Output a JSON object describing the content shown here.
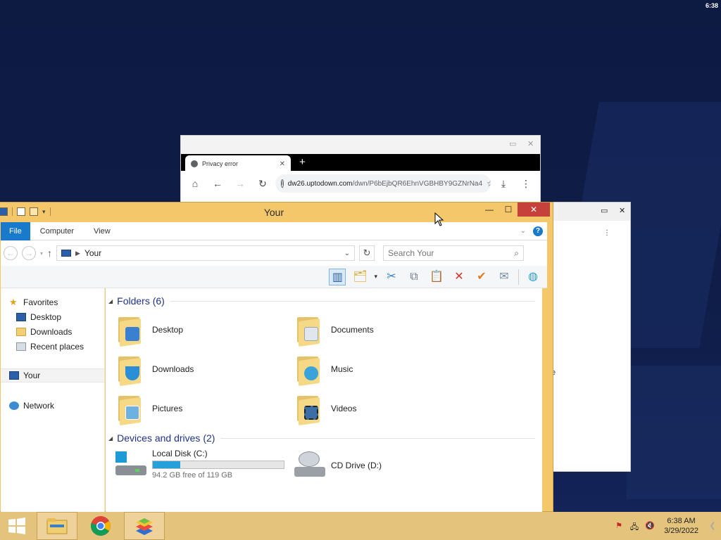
{
  "desktop": {
    "corner_clock": "6:38"
  },
  "chrome": {
    "tab_title": "Privacy error",
    "new_tab": "+",
    "url_host": "dw26.uptodown.com",
    "url_path": "/dwn/P6bEjbQR6EhnVGBHBY9GZNrNa4",
    "minimize": "▭",
    "close": "✕"
  },
  "side_window": {
    "restore": "▭",
    "close": "✕",
    "menu": "⋮",
    "cut_text": "e"
  },
  "explorer": {
    "title": "Your",
    "minimize": "—",
    "maximize": "☐",
    "close": "✕",
    "ribbon_tabs": [
      "File",
      "Computer",
      "View"
    ],
    "help": "?",
    "address": "Your",
    "search_placeholder": "Search Your",
    "nav": {
      "favorites": "Favorites",
      "desktop": "Desktop",
      "downloads": "Downloads",
      "recent": "Recent places",
      "your": "Your",
      "network": "Network"
    },
    "folders_header": "Folders (6)",
    "folders": [
      {
        "name": "Desktop",
        "badge_color": "#3b7fd1"
      },
      {
        "name": "Documents",
        "badge_color": "#dfe6ee"
      },
      {
        "name": "Downloads",
        "badge_color": "#2b8fd8"
      },
      {
        "name": "Music",
        "badge_color": "#3aa3d9"
      },
      {
        "name": "Pictures",
        "badge_color": "#6fb1de"
      },
      {
        "name": "Videos",
        "badge_color": "#3a6ea5"
      }
    ],
    "drives_header": "Devices and drives (2)",
    "drives": [
      {
        "name": "Local Disk (C:)",
        "free": "94.2 GB free of 119 GB",
        "used_fraction": 0.208
      },
      {
        "name": "CD Drive (D:)"
      }
    ]
  },
  "taskbar": {
    "time": "6:38 AM",
    "date": "3/29/2022",
    "tray_chevron": "❮"
  },
  "colors": {
    "titlebar": "#f4c76b",
    "close_red": "#c7413c",
    "file_tab_blue": "#1979ca",
    "group_header_blue": "#1e3287",
    "drive_fill": "#26a0da"
  }
}
